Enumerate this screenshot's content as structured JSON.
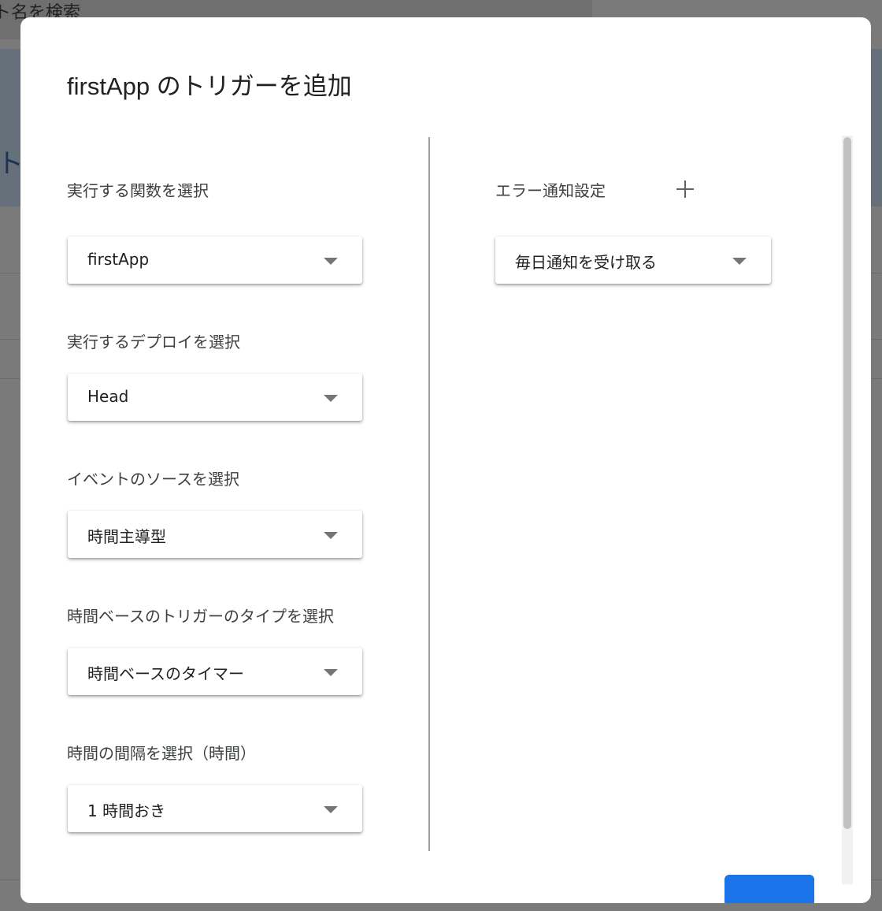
{
  "background": {
    "search_text": "ト名を検索",
    "header_text": "ト"
  },
  "dialog": {
    "title": "firstApp のトリガーを追加",
    "fields": [
      {
        "label": "実行する関数を選択",
        "value": "firstApp"
      },
      {
        "label": "実行するデプロイを選択",
        "value": "Head"
      },
      {
        "label": "イベントのソースを選択",
        "value": "時間主導型"
      },
      {
        "label": "時間ベースのトリガーのタイプを選択",
        "value": "時間ベースのタイマー"
      },
      {
        "label": "時間の間隔を選択（時間）",
        "value": "1 時間おき"
      }
    ],
    "error_notification": {
      "label": "エラー通知設定",
      "value": "毎日通知を受け取る"
    }
  },
  "colors": {
    "primary": "#1a73e8",
    "overlay": "#757575"
  }
}
